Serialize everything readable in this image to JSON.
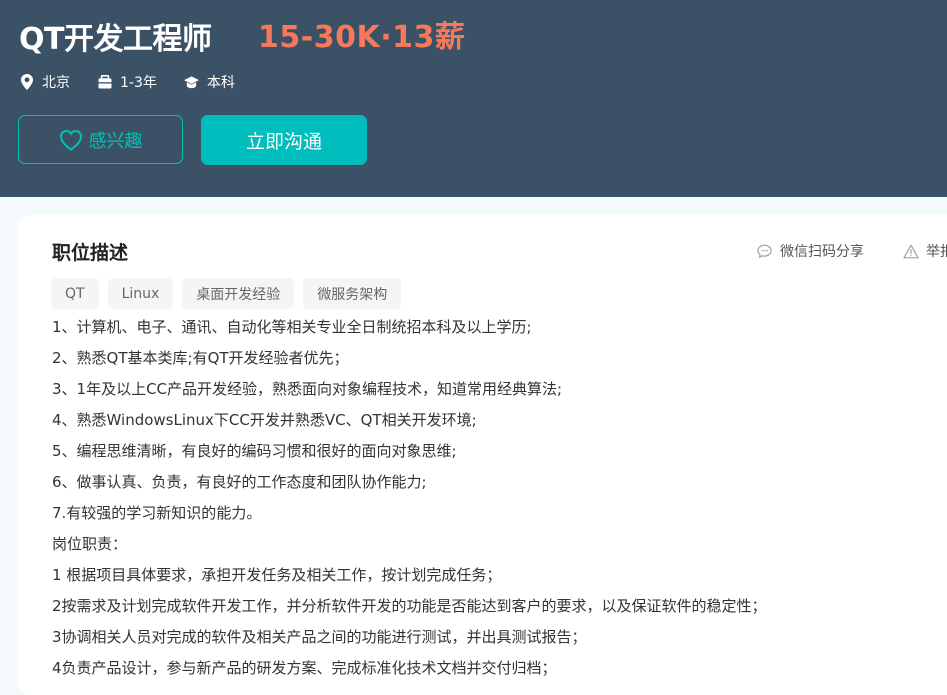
{
  "job": {
    "title": "QT开发工程师",
    "salary": "15-30K·13薪",
    "meta": [
      {
        "icon": "location-pin-icon",
        "text": "北京"
      },
      {
        "icon": "briefcase-icon",
        "text": "1-3年"
      },
      {
        "icon": "graduation-cap-icon",
        "text": "本科"
      }
    ],
    "interest_label": "感兴趣",
    "chat_label": "立即沟通"
  },
  "detail": {
    "section_title": "职位描述",
    "share_label": "微信扫码分享",
    "report_label": "举报",
    "tags": [
      "QT",
      "Linux",
      "桌面开发经验",
      "微服务架构"
    ],
    "lines": [
      "1、计算机、电子、通讯、自动化等相关专业全日制统招本科及以上学历;",
      "2、熟悉QT基本类库;有QT开发经验者优先；",
      "3、1年及以上CC产品开发经验，熟悉面向对象编程技术，知道常用经典算法;",
      "4、熟悉WindowsLinux下CC开发并熟悉VC、QT相关开发环境;",
      "5、编程思维清晰，有良好的编码习惯和很好的面向对象思维;",
      "6、做事认真、负责，有良好的工作态度和团队协作能力;",
      "7.有较强的学习新知识的能力。",
      "岗位职责：",
      "1 根据项目具体要求，承担开发任务及相关工作，按计划完成任务；",
      "2按需求及计划完成软件开发工作，并分析软件开发的功能是否能达到客户的要求，以及保证软件的稳定性；",
      "3协调相关人员对完成的软件及相关产品之间的功能进行测试，并出具测试报告；",
      "4负责产品设计，参与新产品的研发方案、完成标准化技术文档并交付归档；"
    ]
  },
  "colors": {
    "header_bg": "#3b5266",
    "salary": "#f5795a",
    "accent": "#00bebd"
  }
}
